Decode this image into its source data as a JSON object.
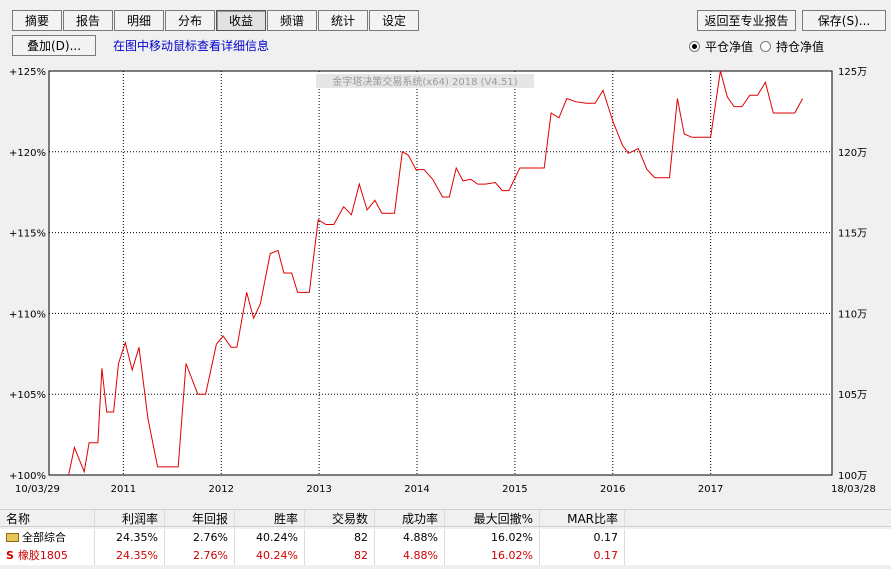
{
  "toolbar": {
    "tabs": [
      "摘要",
      "报告",
      "明细",
      "分布",
      "收益",
      "频谱",
      "统计",
      "设定"
    ],
    "active_tab": "收益",
    "overlay_button": "叠加(D)...",
    "hint": "在图中移动鼠标查看详细信息",
    "return_button": "返回至专业报告",
    "save_button": "保存(S)...",
    "radio_flat": "平仓净值",
    "radio_hold": "持仓净值",
    "radio_selected": "平仓净值"
  },
  "chart_data": {
    "type": "line",
    "title": "金字塔决策交易系统(x64) 2018 (V4.51)",
    "x_start_label": "10/03/29",
    "x_end_label": "18/03/28",
    "x_ticks": [
      "2011",
      "2012",
      "2013",
      "2014",
      "2015",
      "2016",
      "2017"
    ],
    "y_left_ticks": [
      "+100%",
      "+105%",
      "+110%",
      "+115%",
      "+120%",
      "+125%"
    ],
    "y_right_ticks": [
      "100万",
      "105万",
      "110万",
      "115万",
      "120万",
      "125万"
    ],
    "ylim": [
      100,
      125
    ],
    "grid": true,
    "line_color": "#e00000",
    "series": [
      {
        "points": [
          [
            2010.44,
            100.0
          ],
          [
            2010.5,
            101.7
          ],
          [
            2010.6,
            100.2
          ],
          [
            2010.65,
            102.0
          ],
          [
            2010.74,
            102.0
          ],
          [
            2010.78,
            106.6
          ],
          [
            2010.83,
            103.9
          ],
          [
            2010.9,
            103.9
          ],
          [
            2010.95,
            106.9
          ],
          [
            2011.02,
            108.2
          ],
          [
            2011.09,
            106.5
          ],
          [
            2011.16,
            107.9
          ],
          [
            2011.25,
            103.5
          ],
          [
            2011.35,
            100.5
          ],
          [
            2011.45,
            100.5
          ],
          [
            2011.56,
            100.5
          ],
          [
            2011.64,
            106.9
          ],
          [
            2011.76,
            105.0
          ],
          [
            2011.84,
            105.0
          ],
          [
            2011.95,
            108.1
          ],
          [
            2012.02,
            108.6
          ],
          [
            2012.1,
            107.9
          ],
          [
            2012.16,
            107.9
          ],
          [
            2012.26,
            111.3
          ],
          [
            2012.33,
            109.7
          ],
          [
            2012.4,
            110.6
          ],
          [
            2012.5,
            113.7
          ],
          [
            2012.58,
            113.9
          ],
          [
            2012.64,
            112.5
          ],
          [
            2012.72,
            112.5
          ],
          [
            2012.78,
            111.3
          ],
          [
            2012.86,
            111.3
          ],
          [
            2012.9,
            111.3
          ],
          [
            2012.99,
            115.8
          ],
          [
            2013.07,
            115.5
          ],
          [
            2013.15,
            115.5
          ],
          [
            2013.25,
            116.6
          ],
          [
            2013.33,
            116.1
          ],
          [
            2013.41,
            118.0
          ],
          [
            2013.49,
            116.4
          ],
          [
            2013.57,
            117.0
          ],
          [
            2013.64,
            116.2
          ],
          [
            2013.77,
            116.2
          ],
          [
            2013.85,
            120.0
          ],
          [
            2013.91,
            119.8
          ],
          [
            2013.99,
            118.9
          ],
          [
            2014.07,
            118.9
          ],
          [
            2014.16,
            118.3
          ],
          [
            2014.26,
            117.2
          ],
          [
            2014.33,
            117.2
          ],
          [
            2014.4,
            119.0
          ],
          [
            2014.47,
            118.2
          ],
          [
            2014.55,
            118.3
          ],
          [
            2014.62,
            118.0
          ],
          [
            2014.7,
            118.0
          ],
          [
            2014.8,
            118.1
          ],
          [
            2014.87,
            117.6
          ],
          [
            2014.94,
            117.6
          ],
          [
            2015.05,
            119.0
          ],
          [
            2015.15,
            119.0
          ],
          [
            2015.25,
            119.0
          ],
          [
            2015.3,
            119.0
          ],
          [
            2015.37,
            122.4
          ],
          [
            2015.45,
            122.1
          ],
          [
            2015.53,
            123.3
          ],
          [
            2015.62,
            123.1
          ],
          [
            2015.73,
            123.0
          ],
          [
            2015.82,
            123.0
          ],
          [
            2015.9,
            123.8
          ],
          [
            2016.0,
            121.9
          ],
          [
            2016.1,
            120.4
          ],
          [
            2016.16,
            119.9
          ],
          [
            2016.26,
            120.2
          ],
          [
            2016.35,
            118.9
          ],
          [
            2016.43,
            118.4
          ],
          [
            2016.5,
            118.4
          ],
          [
            2016.58,
            118.4
          ],
          [
            2016.66,
            123.3
          ],
          [
            2016.73,
            121.1
          ],
          [
            2016.81,
            120.9
          ],
          [
            2016.9,
            120.9
          ],
          [
            2017.0,
            120.9
          ],
          [
            2017.1,
            125.0
          ],
          [
            2017.17,
            123.4
          ],
          [
            2017.24,
            122.8
          ],
          [
            2017.32,
            122.8
          ],
          [
            2017.4,
            123.5
          ],
          [
            2017.48,
            123.5
          ],
          [
            2017.56,
            124.3
          ],
          [
            2017.64,
            122.4
          ],
          [
            2017.72,
            122.4
          ],
          [
            2017.81,
            122.4
          ],
          [
            2017.86,
            122.4
          ],
          [
            2017.94,
            123.3
          ]
        ]
      }
    ]
  },
  "table": {
    "headers": [
      "名称",
      "利润率",
      "年回报",
      "胜率",
      "交易数",
      "成功率",
      "最大回撤%",
      "MAR比率"
    ],
    "rows": [
      {
        "icon": "folder-icon",
        "name": "全部综合",
        "profit": "24.35%",
        "annual": "2.76%",
        "win": "40.24%",
        "trades": "82",
        "success": "4.88%",
        "drawdown": "16.02%",
        "mar": "0.17"
      },
      {
        "icon": "s-icon",
        "name": "橡胶1805",
        "profit": "24.35%",
        "annual": "2.76%",
        "win": "40.24%",
        "trades": "82",
        "success": "4.88%",
        "drawdown": "16.02%",
        "mar": "0.17",
        "marker": "S"
      }
    ]
  }
}
